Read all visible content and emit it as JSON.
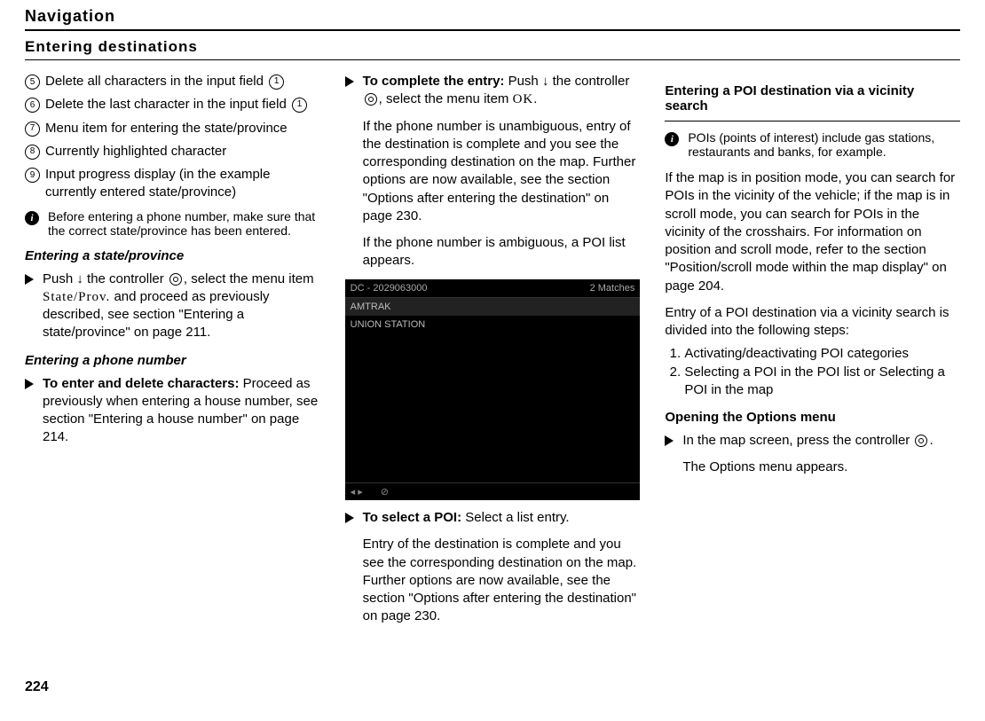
{
  "header": "Navigation",
  "subheader": "Entering destinations",
  "col1": {
    "items": [
      {
        "num": "5",
        "text_a": "Delete all characters in the input field ",
        "ref": "1"
      },
      {
        "num": "6",
        "text_a": "Delete the last character in the input field ",
        "ref": "1"
      },
      {
        "num": "7",
        "text_a": "Menu item for entering the state/province"
      },
      {
        "num": "8",
        "text_a": "Currently highlighted character"
      },
      {
        "num": "9",
        "text_a": "Input progress display (in the example currently entered state/province)"
      }
    ],
    "info1": "Before entering a phone number, make sure that the correct state/province has been entered.",
    "h1": "Entering a state/province",
    "step1a": "Push ",
    "step1b": " the controller ",
    "step1c": ", select the menu item ",
    "step1menu": "State/Prov.",
    "step1d": " and proceed as previously described, see section \"Entering a state/province\" on page 211.",
    "h2": "Entering a phone number",
    "step2bold": "To enter and delete characters:",
    "step2rest": " Proceed as previously when entering a house number, see section \"Entering a house number\" on page 214."
  },
  "col2": {
    "step1bold": "To complete the entry:",
    "step1a": " Push ",
    "step1b": " the controller ",
    "step1c": ", select the menu item ",
    "step1menu": "OK",
    "step1d": ".",
    "body1": "If the phone number is unambiguous, entry of the destination is complete and you see the corresponding destination on the map. Further options are now available, see the section \"Options after entering the destination\" on page 230.",
    "body2": "If the phone number is ambiguous, a POI list appears.",
    "ss_top_left": "DC - 2029063000",
    "ss_top_right": "2 Matches",
    "ss_row1": "AMTRAK",
    "ss_row2": "UNION STATION",
    "ss_bot_a": "◂ ▸",
    "ss_bot_b": "⊘",
    "step2bold": "To select a POI:",
    "step2rest": " Select a list entry.",
    "body3": "Entry of the destination is complete and you see the corresponding destination on the map. Further options are now available, see the section \"Options after entering the destination\" on page 230."
  },
  "col3": {
    "h1": "Entering a POI destination via a vicinity search",
    "info1": "POIs (points of interest) include gas stations, restaurants and banks, for example.",
    "body1": "If the map is in position mode, you can search for POIs in the vicinity of the vehicle; if the map is in scroll mode, you can search for POIs in the vicinity of the crosshairs. For information on position and scroll mode, refer to the section \"Position/scroll mode within the map display\" on page 204.",
    "body2": "Entry of a POI destination via a vicinity search is divided into the following steps:",
    "li1": "Activating/deactivating POI categories",
    "li2": "Selecting a POI in the POI list or Selecting a POI in the map",
    "h2": "Opening the Options menu",
    "step1a": "In the map screen, press the controller ",
    "step1b": ".",
    "body3": "The Options menu appears."
  },
  "pageNumber": "224"
}
